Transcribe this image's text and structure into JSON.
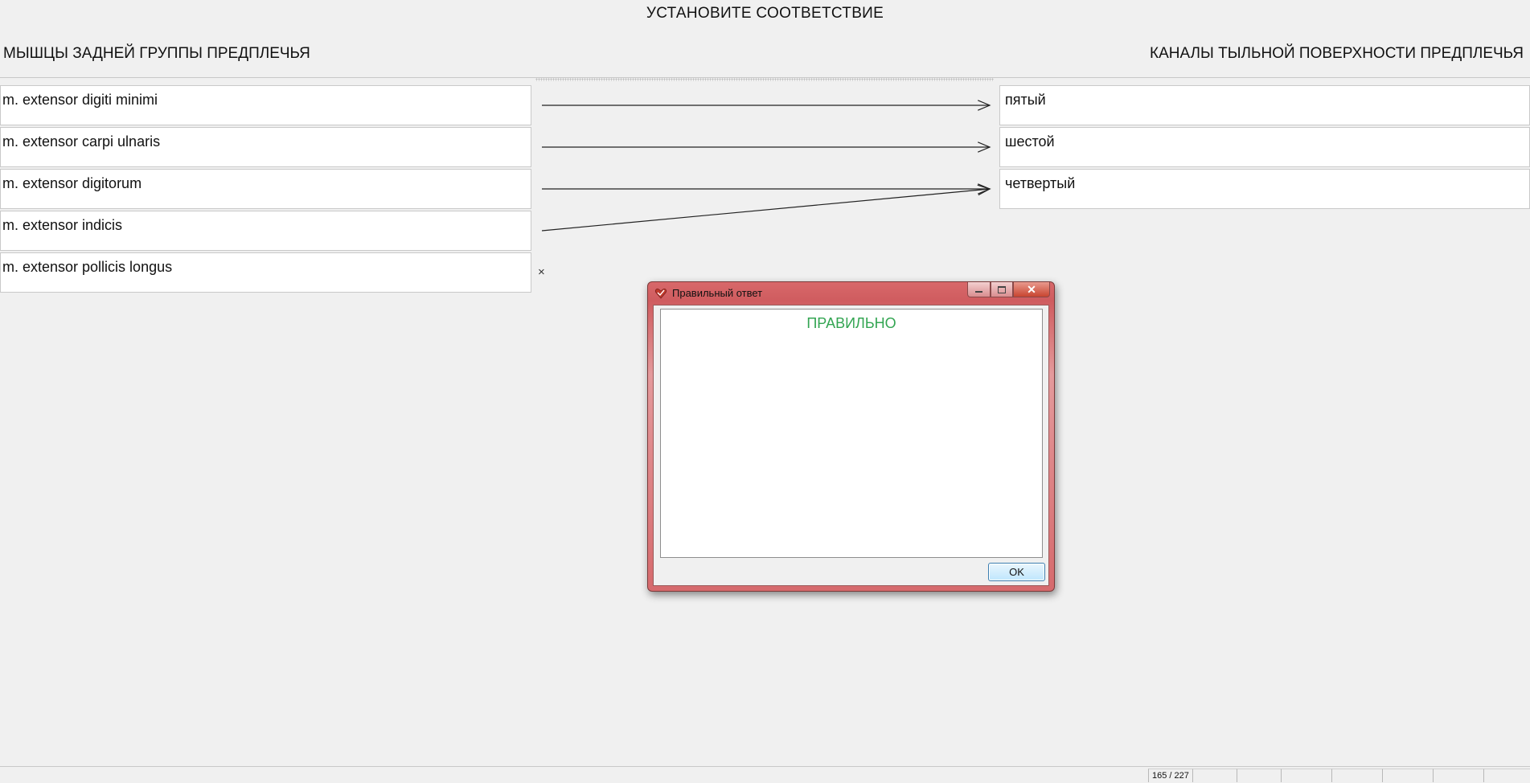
{
  "page": {
    "title": "УСТАНОВИТЕ СООТВЕТСТВИЕ"
  },
  "left_column": {
    "header": "МЫШЦЫ ЗАДНЕЙ ГРУППЫ ПРЕДПЛЕЧЬЯ",
    "items": [
      "m. extensor digiti minimi",
      "m. extensor carpi ulnaris",
      "m. extensor digitorum",
      "m. extensor indicis",
      "m. extensor pollicis longus"
    ]
  },
  "right_column": {
    "header": "КАНАЛЫ ТЫЛЬНОЙ ПОВЕРХНОСТИ ПРЕДПЛЕЧЬЯ",
    "items": [
      "пятый",
      "шестой",
      "четвертый"
    ]
  },
  "connections": [
    {
      "from": 0,
      "to": 0
    },
    {
      "from": 1,
      "to": 1
    },
    {
      "from": 2,
      "to": 2
    },
    {
      "from": 3,
      "to": 2
    }
  ],
  "unmatched_mark": "×",
  "dialog": {
    "title": "Правильный ответ",
    "message": "ПРАВИЛЬНО",
    "ok_label": "OK",
    "message_color": "#33a552"
  },
  "status_bar": {
    "progress": "165 / 227"
  }
}
